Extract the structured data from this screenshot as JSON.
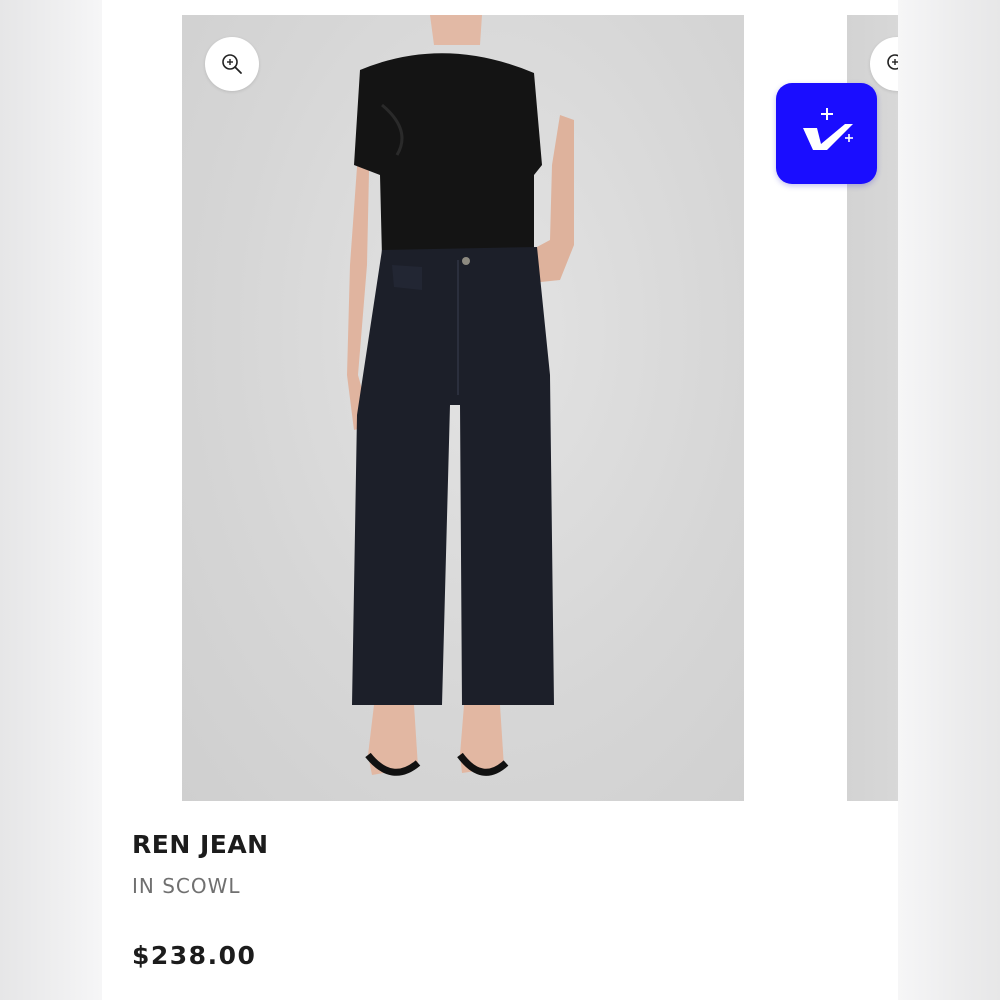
{
  "product": {
    "name": "REN JEAN",
    "color_line": "IN SCOWL",
    "price": "$238.00"
  },
  "icons": {
    "zoom": "zoom-in-icon",
    "badge": "sparkle-check-icon"
  },
  "colors": {
    "badge_bg": "#1a0dff",
    "text_primary": "#1c1c1c",
    "text_secondary": "#707070",
    "photo_bg": "#d6d6d6"
  }
}
